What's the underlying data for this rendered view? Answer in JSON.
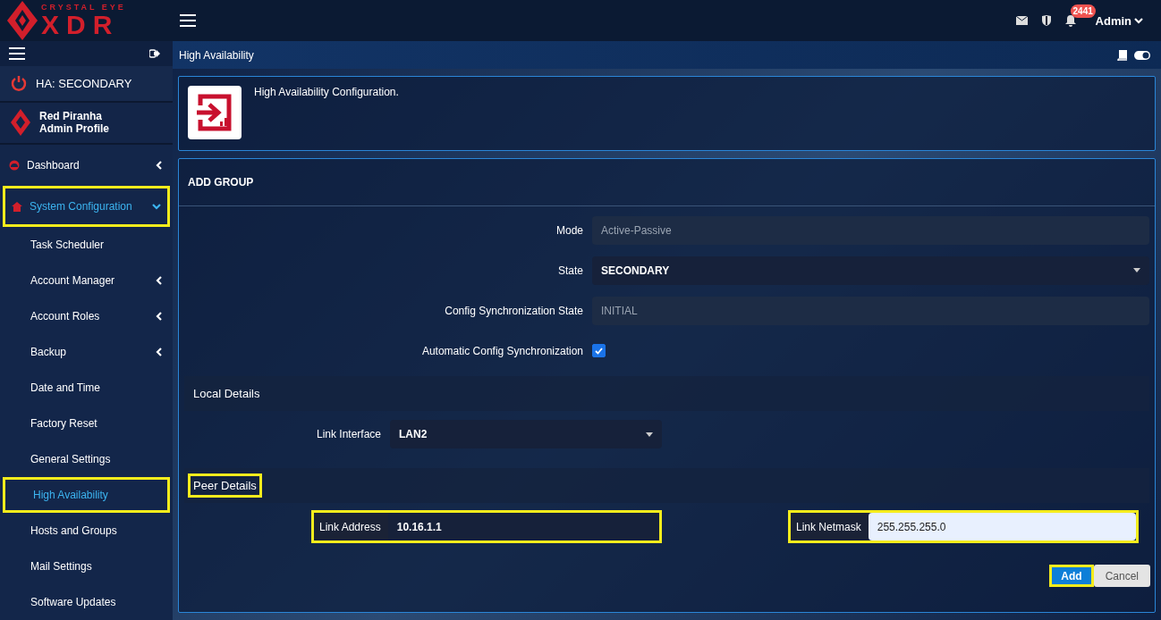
{
  "brand": {
    "tagline": "CRYSTAL EYE",
    "name": "XDR"
  },
  "topbar": {
    "notification_count": "2441",
    "user": "Admin"
  },
  "sidebar": {
    "ha_status": "HA: SECONDARY",
    "profile": {
      "name": "Red Piranha",
      "role": "Admin Profile"
    },
    "items": [
      {
        "label": "Dashboard",
        "expanded": false,
        "has_chevron": true,
        "selected": false,
        "highlighted": false
      },
      {
        "label": "System Configuration",
        "expanded": true,
        "has_chevron": true,
        "selected": true,
        "highlighted": true,
        "children": [
          {
            "label": "Task Scheduler",
            "has_chevron": false,
            "selected": false,
            "highlighted": false
          },
          {
            "label": "Account Manager",
            "has_chevron": true,
            "selected": false,
            "highlighted": false
          },
          {
            "label": "Account Roles",
            "has_chevron": true,
            "selected": false,
            "highlighted": false
          },
          {
            "label": "Backup",
            "has_chevron": true,
            "selected": false,
            "highlighted": false
          },
          {
            "label": "Date and Time",
            "has_chevron": false,
            "selected": false,
            "highlighted": false
          },
          {
            "label": "Factory Reset",
            "has_chevron": false,
            "selected": false,
            "highlighted": false
          },
          {
            "label": "General Settings",
            "has_chevron": false,
            "selected": false,
            "highlighted": false
          },
          {
            "label": "High Availability",
            "has_chevron": false,
            "selected": true,
            "highlighted": true
          },
          {
            "label": "Hosts and Groups",
            "has_chevron": false,
            "selected": false,
            "highlighted": false
          },
          {
            "label": "Mail Settings",
            "has_chevron": false,
            "selected": false,
            "highlighted": false
          },
          {
            "label": "Software Updates",
            "has_chevron": false,
            "selected": false,
            "highlighted": false
          }
        ]
      }
    ]
  },
  "page": {
    "title": "High Availability",
    "description": "High Availability Configuration."
  },
  "form": {
    "title": "ADD GROUP",
    "fields": [
      {
        "kind": "readonly",
        "label": "Mode",
        "value": "Active-Passive"
      },
      {
        "kind": "select",
        "label": "State",
        "value": "SECONDARY"
      },
      {
        "kind": "readonly",
        "label": "Config Synchronization State",
        "value": "INITIAL"
      },
      {
        "kind": "checkbox",
        "label": "Automatic Config Synchronization",
        "checked": true
      }
    ],
    "local": {
      "title": "Local Details",
      "highlighted": false,
      "field": {
        "label": "Link Interface",
        "value": "LAN2"
      }
    },
    "peer": {
      "title": "Peer Details",
      "highlighted": true,
      "fields": [
        {
          "label": "Link Address",
          "value": "10.16.1.1",
          "focused": false,
          "highlighted": true
        },
        {
          "label": "Link Netmask",
          "value": "255.255.255.0",
          "focused": true,
          "highlighted": true
        }
      ]
    },
    "buttons": [
      {
        "kind": "primary",
        "label": "Add",
        "highlighted": true
      },
      {
        "kind": "secondary",
        "label": "Cancel",
        "highlighted": false
      }
    ]
  }
}
